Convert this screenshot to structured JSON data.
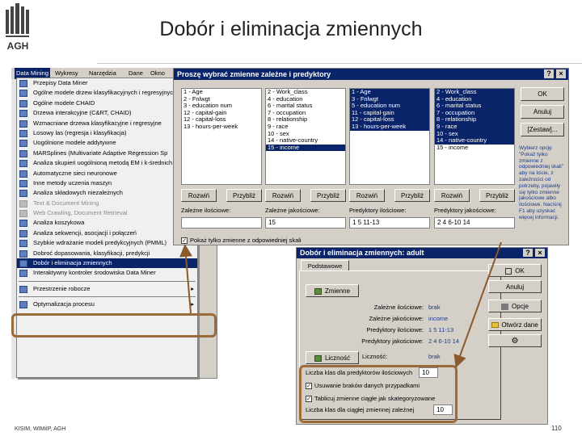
{
  "slide": {
    "title": "Dobór i eliminacja zmiennych",
    "logo": "AGH",
    "footer": "KISIM, WIMiIP, AGH",
    "page": "110"
  },
  "menubar": {
    "items": [
      "Data Mining",
      "Wykresy",
      "Narzędzia",
      "Dane",
      "Okno"
    ]
  },
  "menu": {
    "items": [
      {
        "label": "Przepisy Data Miner",
        "icon": "recipe-icon"
      },
      {
        "label": "Ogólne modele drzew klasyfikacyjnych i regresyjnych",
        "icon": "tree-icon"
      },
      {
        "label": "Ogólne modele CHAID",
        "icon": "chaid-icon"
      },
      {
        "label": "Drzewa interakcyjne (C&RT, CHAID)",
        "icon": "interactive-tree-icon"
      },
      {
        "label": "Wzmacniane drzewa klasyfikacyjne i regresyjne",
        "icon": "boosted-tree-icon"
      },
      {
        "label": "Losowy las (regresja i klasyfikacja)",
        "icon": "forest-icon"
      },
      {
        "label": "Uogólnione modele addytywne",
        "icon": "additive-model-icon"
      },
      {
        "label": "MARSplines (Multivariate Adaptive Regression Sp",
        "icon": "marsplines-icon"
      },
      {
        "label": "Analiza skupień uogólnioną metodą EM i k-średnich",
        "icon": "cluster-icon"
      },
      {
        "label": "Automatyczne sieci neuronowe",
        "icon": "neural-network-icon"
      },
      {
        "label": "Inne metody uczenia maszyn",
        "icon": "machine-learning-icon"
      },
      {
        "label": "Analiza składowych niezależnych",
        "icon": "ica-icon"
      },
      {
        "label": "Text & Document Mining",
        "icon": "text-mining-icon",
        "disabled": true
      },
      {
        "label": "Web Crawling, Document Retrieval",
        "icon": "web-crawl-icon",
        "disabled": true
      },
      {
        "label": "Analiza koszykowa",
        "icon": "basket-icon"
      },
      {
        "label": "Analiza sekwencji, asocjacji i połączeń",
        "icon": "sequence-icon"
      },
      {
        "label": "Szybkie wdrażanie modeli predykcyjnych (PMML)",
        "icon": "pmml-icon"
      },
      {
        "label": "Dobroć dopasowania, klasyfikacji, predykcji",
        "icon": "goodness-fit-icon"
      },
      {
        "label": "Dobór i eliminacja zmiennych",
        "icon": "feature-selection-icon",
        "highlighted": true
      },
      {
        "label": "Interaktywny kontroler środowiska Data Miner",
        "icon": "controller-icon"
      },
      {
        "label": "Przestrzenie robocze",
        "icon": "workspace-icon",
        "submenu": true,
        "separator_before": true
      },
      {
        "label": "Optymalizacja procesu",
        "icon": "optimization-icon",
        "submenu": true,
        "separator_before": true
      }
    ]
  },
  "varDialog": {
    "title": "Proszę wybrać zmienne zależne i predyktory",
    "lists": [
      {
        "items": [
          "1 - Age",
          "2 - Fnlwgt",
          "3 - education num",
          "12 - capital-gain",
          "12 - capital-loss",
          "13 - hours-per-week"
        ],
        "selected": []
      },
      {
        "items": [
          "2 - Work_class",
          "4 - education",
          "6 - marital status",
          "7 - occupation",
          "8 - relationship",
          "9 - race",
          "10 - sex",
          "14 - native-country",
          "15 - income"
        ],
        "selected": [
          8
        ]
      },
      {
        "items": [
          "1 - Age",
          "3 - Fnlwgt",
          "5 - education num",
          "11 - capital-gain",
          "12 - capital-loss",
          "13 - hours-per-week"
        ],
        "selected": [
          0,
          1,
          2,
          3,
          4,
          5
        ]
      },
      {
        "items": [
          "2 - Work_class",
          "4 - education",
          "6 - marital status",
          "7 - occupation",
          "8 - relationship",
          "9 - race",
          "10 - sex",
          "14 - native-country",
          "15 - income"
        ],
        "selected": [
          0,
          1,
          2,
          3,
          4,
          5,
          6,
          7
        ]
      }
    ],
    "buttons": {
      "rozwin": "Rozwiń",
      "przybliz": "Przybliż",
      "ok": "OK",
      "anuluj": "Anuluj",
      "zestaw": "[Zestaw]..."
    },
    "fields": [
      {
        "label": "Zależne ilościowe:",
        "value": ""
      },
      {
        "label": "Zależne jakościowe:",
        "value": "15"
      },
      {
        "label": "Predyktory ilościowe:",
        "value": "1 5 11-13"
      },
      {
        "label": "Predyktory jakościowe:",
        "value": "2 4 6-10 14"
      }
    ],
    "checkbox": "Pokaż tylko zmienne z odpowiedniej skali",
    "hint": "Wybierz opcję \"Pokaż tylko zmienne z odpowiedniej skali\" aby na liście, z zależności od potrzeby, pojawiły się tylko zmienne jakościowe albo ilościowe. Naciśnij F1 aby uzyskać więcej informacji."
  },
  "mainDialog": {
    "title": "Dobór i eliminacja zmiennych: adult",
    "tab": "Podstawowe",
    "buttons": {
      "zmienne": "Zmienne",
      "licznosc": "Liczność",
      "ok": "OK",
      "anuluj": "Anuluj",
      "opcje": "Opcje",
      "otworz": "Otwórz dane"
    },
    "rows": [
      {
        "label": "Zależne ilościowe:",
        "value": "brak"
      },
      {
        "label": "Zależne jakościowe:",
        "value": "income"
      },
      {
        "label": "Predyktory ilościowe:",
        "value": "1 5 11-13"
      },
      {
        "label": "Predyktory jakościowe:",
        "value": "2 4 6-10 14"
      },
      {
        "label": "Liczność:",
        "value": "brak"
      }
    ],
    "options": [
      {
        "label": "Liczba klas dla predyktorów ilościowych",
        "value": "10",
        "type": "spin"
      },
      {
        "label": "Usuwanie braków danych przypadkami",
        "type": "check",
        "checked": true
      },
      {
        "label": "Tablicuj zmienne ciągłe jak skategoryzowane",
        "type": "check",
        "checked": true
      },
      {
        "label": "Liczba klas dla ciągłej zmiennej zależnej",
        "value": "10",
        "type": "spin"
      }
    ]
  },
  "colors": {
    "titlebar": "#0a246a",
    "window": "#d4d0c8",
    "highlight_box": "#9c6b3a",
    "arrow": "#8b5a2b"
  }
}
